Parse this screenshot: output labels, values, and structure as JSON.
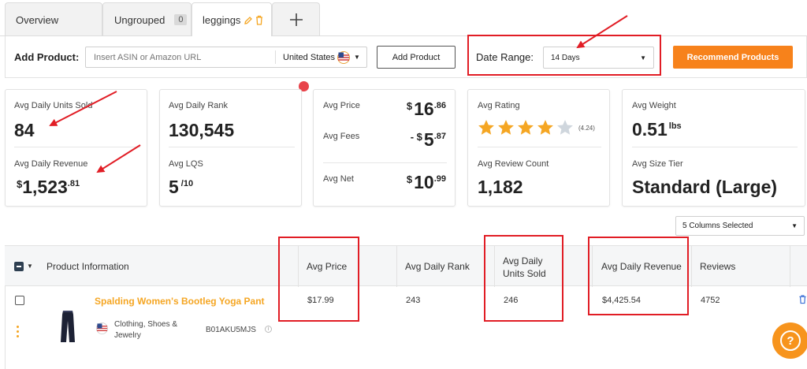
{
  "tabs": [
    {
      "label": "Overview"
    },
    {
      "label": "Ungrouped",
      "badge": "0"
    },
    {
      "label": "leggings"
    }
  ],
  "add_product": {
    "label": "Add Product:",
    "input_placeholder": "Insert ASIN or Amazon URL",
    "country": "United States",
    "add_button": "Add Product"
  },
  "date_range": {
    "label": "Date Range:",
    "value": "14 Days"
  },
  "recommend_button": "Recommend Products",
  "stats": {
    "units_sold_label": "Avg Daily Units Sold",
    "units_sold": "84",
    "revenue_label": "Avg Daily Revenue",
    "revenue_currency": "$",
    "revenue_main": "1,523",
    "revenue_cents": ".81",
    "rank_label": "Avg Daily Rank",
    "rank": "130,545",
    "lqs_label": "Avg LQS",
    "lqs": "5",
    "lqs_of": "/10",
    "price_label": "Avg Price",
    "price_main": "16",
    "price_cents": ".86",
    "fees_label": "Avg Fees",
    "fees_prefix": "- $",
    "fees_main": "5",
    "fees_cents": ".87",
    "net_label": "Avg Net",
    "net_main": "10",
    "net_cents": ".99",
    "currency": "$",
    "rating_label": "Avg Rating",
    "rating_value": 4.24,
    "rating_text": "(4.24)",
    "review_count_label": "Avg Review Count",
    "review_count": "1,182",
    "weight_label": "Avg Weight",
    "weight": "0.51",
    "weight_unit": "lbs",
    "size_tier_label": "Avg Size Tier",
    "size_tier": "Standard (Large)"
  },
  "columns_selector": "5 Columns Selected",
  "table": {
    "headers": [
      "Product Information",
      "Avg Price",
      "Avg Daily Rank",
      "Avg Daily Units Sold",
      "Avg Daily Revenue",
      "Reviews"
    ],
    "rows": [
      {
        "title": "Spalding Women's Bootleg Yoga Pant",
        "category": "Clothing, Shoes & Jewelry",
        "asin": "B01AKU5MJS",
        "price": "$17.99",
        "rank": "243",
        "units": "246",
        "revenue": "$4,425.54",
        "reviews": "4752"
      }
    ]
  },
  "colors": {
    "accent_orange": "#f7821b",
    "annotation_red": "#e11d25",
    "link_orange": "#f5a623",
    "star_filled": "#f5a623",
    "star_empty": "#cfd6dd",
    "header_bg": "#f5f6f7",
    "checkbox_navy": "#2d3e50"
  },
  "icons": [
    "edit-pencil-icon",
    "trash-icon",
    "plus-icon",
    "us-flag-icon",
    "caret-down-icon",
    "star-icon",
    "info-icon",
    "kebab-menu-icon",
    "help-icon",
    "notification-dot-icon"
  ]
}
